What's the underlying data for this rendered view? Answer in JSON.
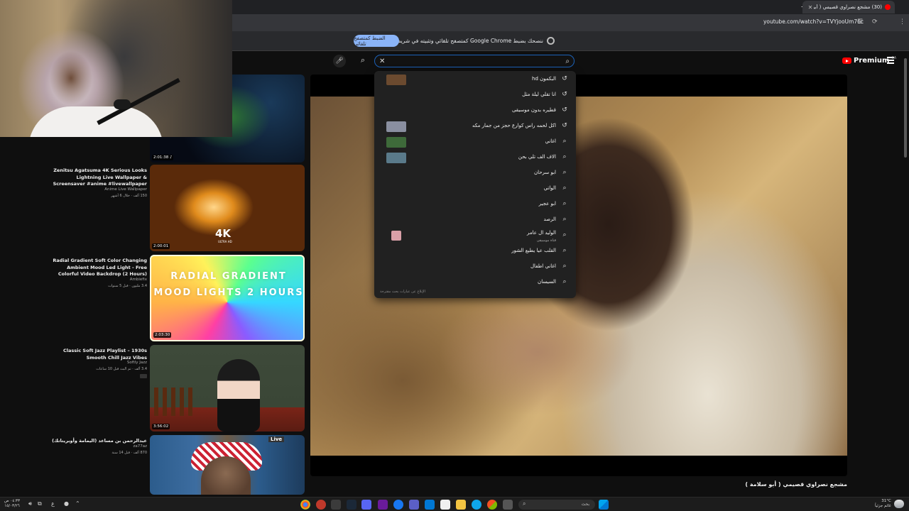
{
  "browser": {
    "tab_title": "(30) مشجع نصراوي قصيمي ( أبو",
    "tab_close": "✕",
    "new_tab": "+",
    "url": "youtube.com/watch?v=TVYjooUm76c",
    "infobar_message": "ننصحك بضبط Google Chrome كمتصفح تلقائي وتثبيته في شريط المهام",
    "infobar_button": "الضبط كمتصفح تلقائي"
  },
  "youtube": {
    "logo_text": "Premium",
    "logo_region": "SA",
    "search_value": "",
    "search_clear": "✕",
    "suggestions": [
      {
        "icon": "history",
        "text": "البكمون hd",
        "sub": "",
        "thumb": "#6b4a2f"
      },
      {
        "icon": "history",
        "text": "انا تقلي ليلة مثل",
        "sub": "",
        "thumb": ""
      },
      {
        "icon": "history",
        "text": "قطيره بدون موسيقى",
        "sub": "",
        "thumb": ""
      },
      {
        "icon": "history",
        "text": "اكل لحمه راس كوارع حجز من جمار مكه",
        "sub": "",
        "thumb": "#8a8fa0"
      },
      {
        "icon": "search",
        "text": "اغاني",
        "sub": "",
        "thumb": "#3e6a3a"
      },
      {
        "icon": "search",
        "text": "الاف الف تلي بحن",
        "sub": "",
        "thumb": "#5a7a8a"
      },
      {
        "icon": "search",
        "text": "ابو سرحان",
        "sub": "",
        "thumb": ""
      },
      {
        "icon": "search",
        "text": "الواتي",
        "sub": "",
        "thumb": ""
      },
      {
        "icon": "search",
        "text": "ابو عجير",
        "sub": "",
        "thumb": ""
      },
      {
        "icon": "search",
        "text": "الرصد",
        "sub": "",
        "thumb": ""
      },
      {
        "icon": "search",
        "text": "الوليد ال عامر",
        "sub": "قناة موسيقى",
        "thumb": "#d9a0a8"
      },
      {
        "icon": "search",
        "text": "القلب عيا يطيع الشور",
        "sub": "",
        "thumb": ""
      },
      {
        "icon": "search",
        "text": "اغاني اطفال",
        "sub": "",
        "thumb": ""
      },
      {
        "icon": "search",
        "text": "السيسان",
        "sub": "",
        "thumb": ""
      }
    ],
    "dropdown_footer": "الإبلاغ عن عبارات بحث مقترحة",
    "video_title": "مشجع نصراوي قصيمي ( أبو سلامة )"
  },
  "sidebar": {
    "cards": [
      {
        "title": "",
        "channel": "",
        "meta": "",
        "duration": "2:01:38 ♪"
      },
      {
        "title": "Zenitsu Agatsuma 4K Serious Looks Lightning Live Wallpaper & Screensaver #anime #livewallpaper",
        "channel": "Anime Live Wallpaper",
        "meta": "150 ألف · خلال 6 أشهر",
        "duration": "2:00:01",
        "thumb_text": "4K",
        "thumb_sub": "ULTRA HD"
      },
      {
        "title": "Radial Gradient Soft Color Changing Ambient Mood Led Light - Free Colorful Video Backdrop (2 Hours)",
        "channel": "Ambiefix",
        "meta": "3.4 مليون · قبل 5 سنوات",
        "duration": "2:03:30",
        "thumb_text": "RADIAL GRADIENT MOOD LIGHTS 2 HOURS"
      },
      {
        "title": "Classic Soft Jazz Playlist – 1930s Smooth Chill Jazz Vibes",
        "channel": "Softly Jazz",
        "meta": "3.4 ألف · تم البث قبل 10 ساعات",
        "duration": "3:56:02"
      },
      {
        "title": "عبدالرحمن بن مساعد (اليمامة وأوبريتاتك)",
        "channel": "za77az",
        "meta": "870 ألف · قبل 14 سنة",
        "duration": "",
        "live_badge": "Live"
      }
    ]
  },
  "taskbar": {
    "search_label": "بحث",
    "weather_temp": "31°C",
    "weather_desc": "غائم جزئياً",
    "clock_time": "٠٤:٣٣ ص",
    "clock_date": "١٥/٠٣/٢٦",
    "lang": "ع"
  }
}
